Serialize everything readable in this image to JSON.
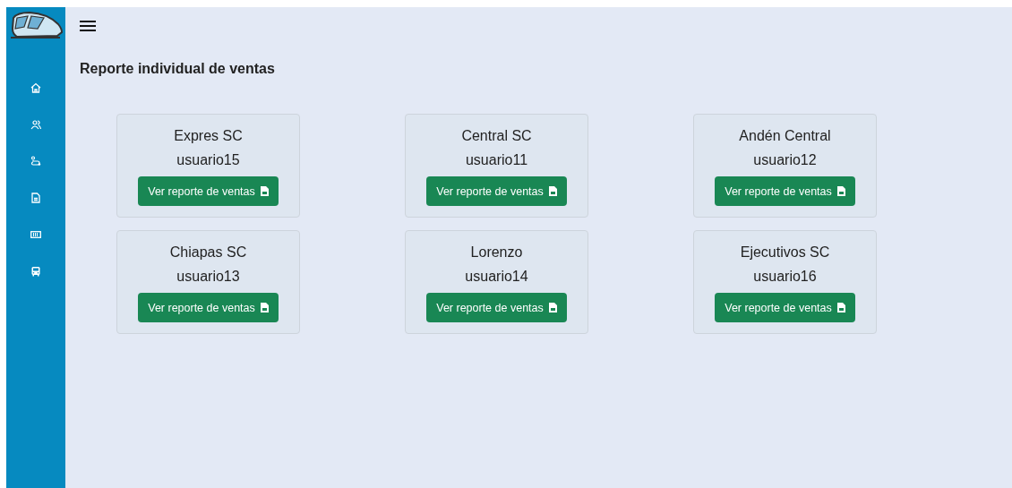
{
  "page_title": "Reporte individual de ventas",
  "sidebar": {
    "items": [
      {
        "kind": "home"
      },
      {
        "kind": "users"
      },
      {
        "kind": "route"
      },
      {
        "kind": "document"
      },
      {
        "kind": "ticket"
      },
      {
        "kind": "bus"
      }
    ]
  },
  "cards": [
    {
      "name": "Expres SC",
      "user": "usuario15",
      "button": "Ver reporte de ventas"
    },
    {
      "name": "Central SC",
      "user": "usuario11",
      "button": "Ver reporte de ventas"
    },
    {
      "name": "Andén Central",
      "user": "usuario12",
      "button": "Ver reporte de ventas"
    },
    {
      "name": "Chiapas SC",
      "user": "usuario13",
      "button": "Ver reporte de ventas"
    },
    {
      "name": "Lorenzo",
      "user": "usuario14",
      "button": "Ver reporte de ventas"
    },
    {
      "name": "Ejecutivos SC",
      "user": "usuario16",
      "button": "Ver reporte de ventas"
    }
  ]
}
